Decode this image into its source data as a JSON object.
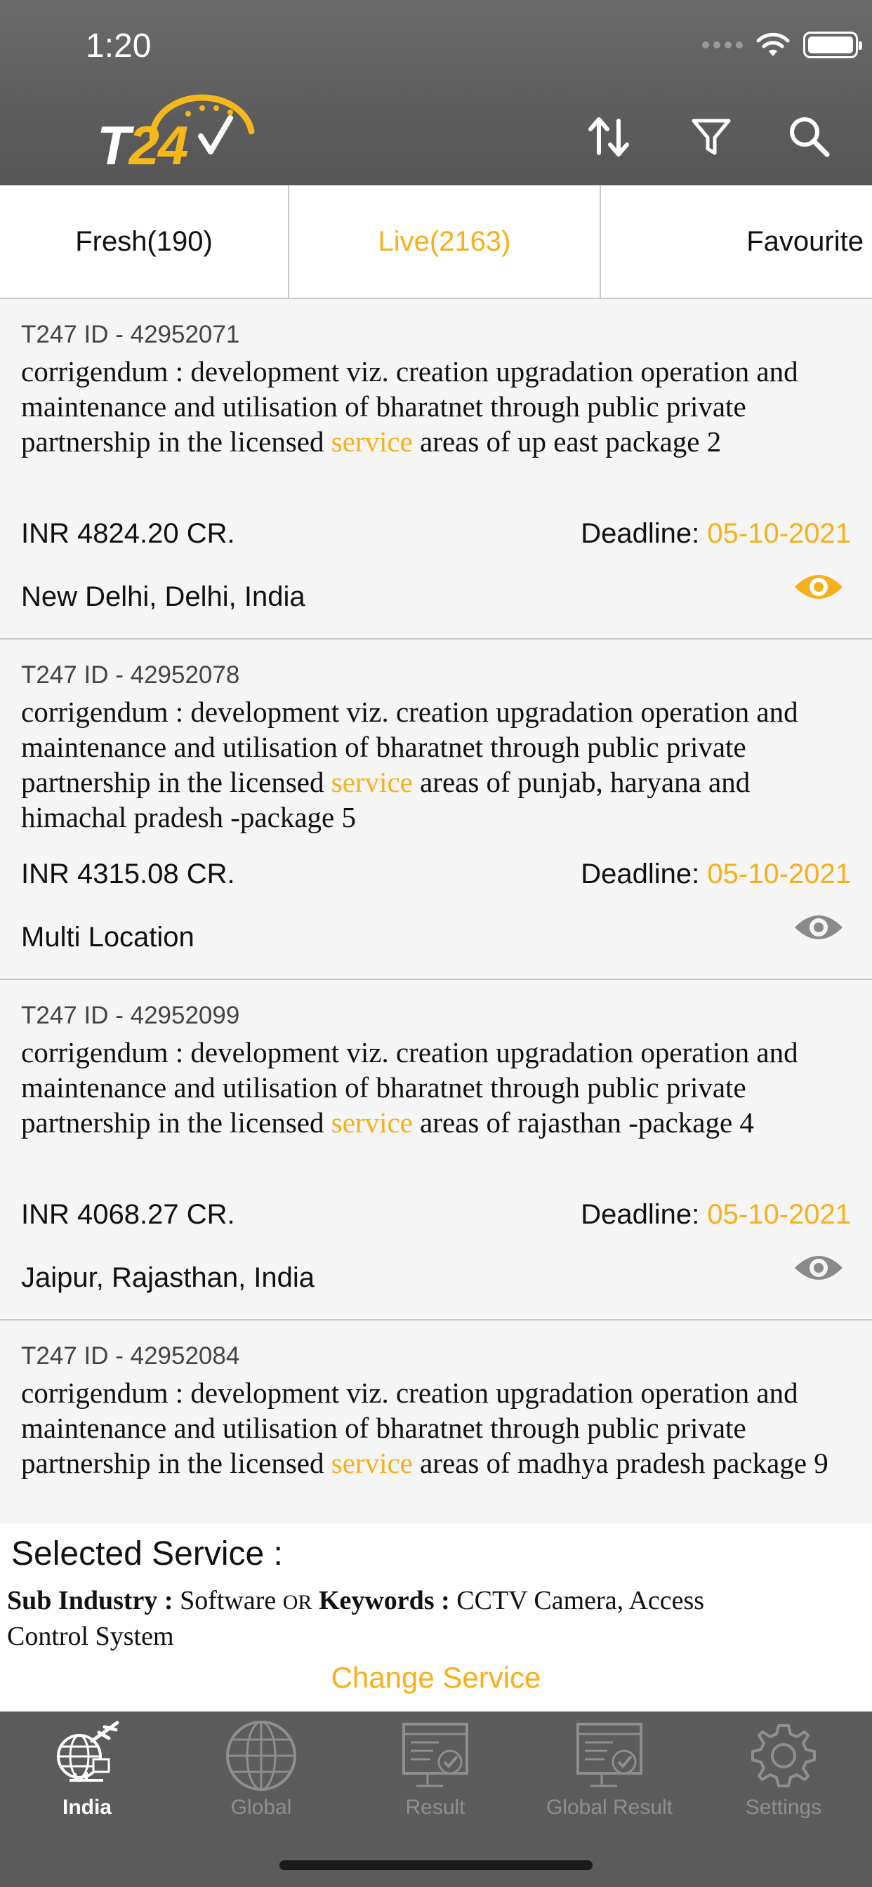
{
  "status_bar": {
    "time": "1:20"
  },
  "header": {
    "logo": {
      "t": "T",
      "num": "24",
      "seven": "7"
    },
    "icons": {
      "sort": "sort-arrows-icon",
      "filter": "filter-funnel-icon",
      "search": "search-icon"
    }
  },
  "tabs": [
    {
      "label": "Fresh(190)",
      "active": false
    },
    {
      "label": "Live(2163)",
      "active": true
    },
    {
      "label": "Favourite",
      "active": false
    }
  ],
  "tenders": [
    {
      "id": "T247 ID - 42952071",
      "desc_pre": "corrigendum : development viz. creation upgradation operation and maintenance and utilisation of bharatnet through public private partnership in the licensed ",
      "desc_hl": "service",
      "desc_post": " areas of up east package 2",
      "amount": "INR 4824.20 CR.",
      "deadline_label": "Deadline: ",
      "deadline": "05-10-2021",
      "location": "New Delhi, Delhi, India",
      "viewed": true
    },
    {
      "id": "T247 ID - 42952078",
      "desc_pre": "corrigendum : development viz. creation upgradation operation and maintenance and utilisation of bharatnet through public private partnership in the licensed ",
      "desc_hl": "service",
      "desc_post": " areas of punjab, haryana and himachal pradesh -package 5",
      "amount": "INR 4315.08 CR.",
      "deadline_label": "Deadline: ",
      "deadline": "05-10-2021",
      "location": "Multi Location",
      "viewed": false
    },
    {
      "id": "T247 ID - 42952099",
      "desc_pre": "corrigendum : development viz. creation upgradation operation and maintenance and utilisation of bharatnet through public private partnership in the licensed ",
      "desc_hl": "service",
      "desc_post": " areas of rajasthan -package 4",
      "amount": "INR 4068.27 CR.",
      "deadline_label": "Deadline: ",
      "deadline": "05-10-2021",
      "location": "Jaipur, Rajasthan, India",
      "viewed": false
    },
    {
      "id": "T247 ID - 42952084",
      "desc_pre": "corrigendum : development viz. creation upgradation operation and maintenance and utilisation of bharatnet through public private partnership in the licensed ",
      "desc_hl": "service",
      "desc_post": " areas of madhya pradesh package 9",
      "amount": "",
      "deadline_label": "",
      "deadline": "",
      "location": "",
      "viewed": false
    }
  ],
  "selected_service": {
    "title": "Selected Service :",
    "sub_industry_label": "Sub Industry :",
    "sub_industry_value": " Software ",
    "or_text": "OR",
    "keywords_label": " Keywords :",
    "keywords_value": " CCTV Camera, Access Control System",
    "change_label": "Change Service"
  },
  "bottom_nav": [
    {
      "label": "India",
      "icon": "india-globe-plane-icon",
      "active": true
    },
    {
      "label": "Global",
      "icon": "globe-icon",
      "active": false
    },
    {
      "label": "Result",
      "icon": "result-monitor-icon",
      "active": false
    },
    {
      "label": "Global Result",
      "icon": "global-result-monitor-icon",
      "active": false
    },
    {
      "label": "Settings",
      "icon": "settings-gear-icon",
      "active": false
    }
  ],
  "colors": {
    "accent": "#f5b01a",
    "header": "#5f5f5f",
    "nav": "#5c5c5c",
    "eye_inactive": "#8a8a8a"
  }
}
